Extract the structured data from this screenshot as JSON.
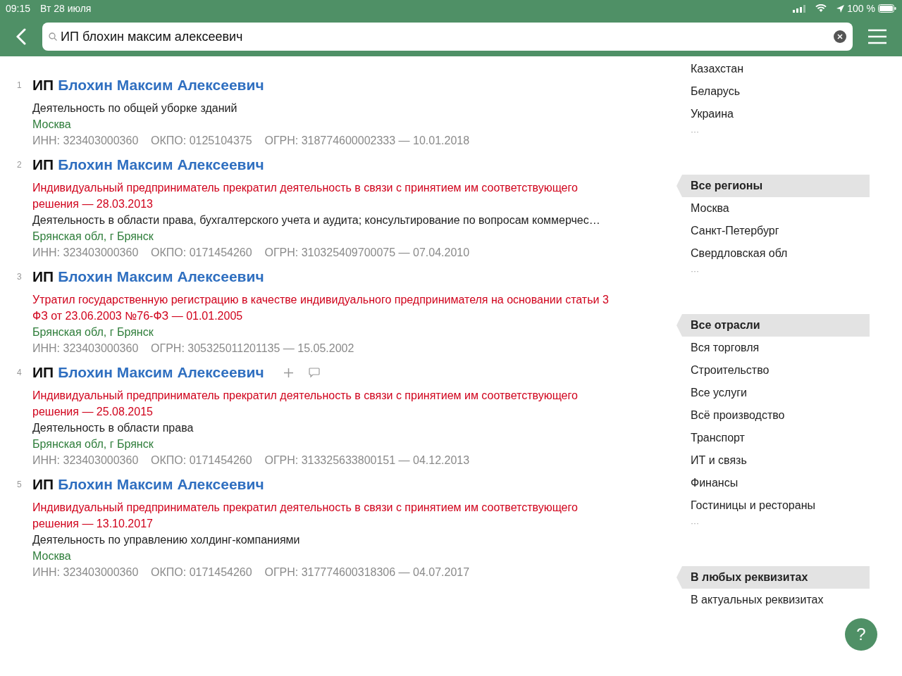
{
  "status_bar": {
    "time": "09:15",
    "date": "Вт 28 июля",
    "battery": "100 %"
  },
  "search": {
    "value": "ИП блохин максим алексеевич"
  },
  "results": [
    {
      "number": "1",
      "prefix": "ИП",
      "name": "Блохин Максим Алексеевич",
      "actions": false,
      "lines": [
        {
          "kind": "activity",
          "text": "Деятельность по общей уборке зданий"
        },
        {
          "kind": "location",
          "text": "Москва"
        },
        {
          "kind": "ids",
          "text": "ИНН: 323403000360    ОКПО: 0125104375    ОГРН: 318774600002333 — 10.01.2018"
        }
      ]
    },
    {
      "number": "2",
      "prefix": "ИП",
      "name": "Блохин Максим Алексеевич",
      "actions": false,
      "lines": [
        {
          "kind": "status",
          "text": "Индивидуальный предприниматель прекратил деятельность в связи с принятием им соответствующего решения — 28.03.2013"
        },
        {
          "kind": "activity",
          "text": "Деятельность в области права, бухгалтерского учета и аудита; консультирование по вопросам коммерчес…"
        },
        {
          "kind": "location",
          "text": "Брянская обл, г Брянск"
        },
        {
          "kind": "ids",
          "text": "ИНН: 323403000360    ОКПО: 0171454260    ОГРН: 310325409700075 — 07.04.2010"
        }
      ]
    },
    {
      "number": "3",
      "prefix": "ИП",
      "name": "Блохин Максим Алексеевич",
      "actions": false,
      "lines": [
        {
          "kind": "status",
          "text": "Утратил государственную регистрацию в качестве индивидуального предпринимателя на основании статьи 3 ФЗ от 23.06.2003 №76-ФЗ — 01.01.2005"
        },
        {
          "kind": "location",
          "text": "Брянская обл, г Брянск"
        },
        {
          "kind": "ids",
          "text": "ИНН: 323403000360    ОГРН: 305325011201135 — 15.05.2002"
        }
      ]
    },
    {
      "number": "4",
      "prefix": "ИП",
      "name": "Блохин Максим Алексеевич",
      "actions": true,
      "lines": [
        {
          "kind": "status",
          "text": "Индивидуальный предприниматель прекратил деятельность в связи с принятием им соответствующего решения — 25.08.2015"
        },
        {
          "kind": "activity",
          "text": "Деятельность в области права"
        },
        {
          "kind": "location",
          "text": "Брянская обл, г Брянск"
        },
        {
          "kind": "ids",
          "text": "ИНН: 323403000360    ОКПО: 0171454260    ОГРН: 313325633800151 — 04.12.2013"
        }
      ]
    },
    {
      "number": "5",
      "prefix": "ИП",
      "name": "Блохин Максим Алексеевич",
      "actions": false,
      "lines": [
        {
          "kind": "status",
          "text": "Индивидуальный предприниматель прекратил деятельность в связи с принятием им соответствующего решения — 13.10.2017"
        },
        {
          "kind": "activity",
          "text": "Деятельность по управлению холдинг-компаниями"
        },
        {
          "kind": "location",
          "text": "Москва"
        },
        {
          "kind": "ids",
          "text": "ИНН: 323403000360    ОКПО: 0171454260    ОГРН: 317774600318306 — 04.07.2017"
        }
      ]
    }
  ],
  "filters": [
    {
      "items": [
        {
          "label": "Казахстан",
          "selected": false
        },
        {
          "label": "Беларусь",
          "selected": false
        },
        {
          "label": "Украина",
          "selected": false
        }
      ],
      "more": "···"
    },
    {
      "items": [
        {
          "label": "Все регионы",
          "selected": true
        },
        {
          "label": "Москва",
          "selected": false
        },
        {
          "label": "Санкт-Петербург",
          "selected": false
        },
        {
          "label": "Свердловская обл",
          "selected": false
        }
      ],
      "more": "···"
    },
    {
      "items": [
        {
          "label": "Все отрасли",
          "selected": true
        },
        {
          "label": "Вся торговля",
          "selected": false
        },
        {
          "label": "Строительство",
          "selected": false
        },
        {
          "label": "Все услуги",
          "selected": false
        },
        {
          "label": "Всё производство",
          "selected": false
        },
        {
          "label": "Транспорт",
          "selected": false
        },
        {
          "label": "ИТ и связь",
          "selected": false
        },
        {
          "label": "Финансы",
          "selected": false
        },
        {
          "label": "Гостиницы и рестораны",
          "selected": false
        }
      ],
      "more": "···"
    },
    {
      "items": [
        {
          "label": "В любых реквизитах",
          "selected": true
        },
        {
          "label": "В актуальных реквизитах",
          "selected": false
        }
      ]
    }
  ],
  "help": {
    "label": "?"
  }
}
